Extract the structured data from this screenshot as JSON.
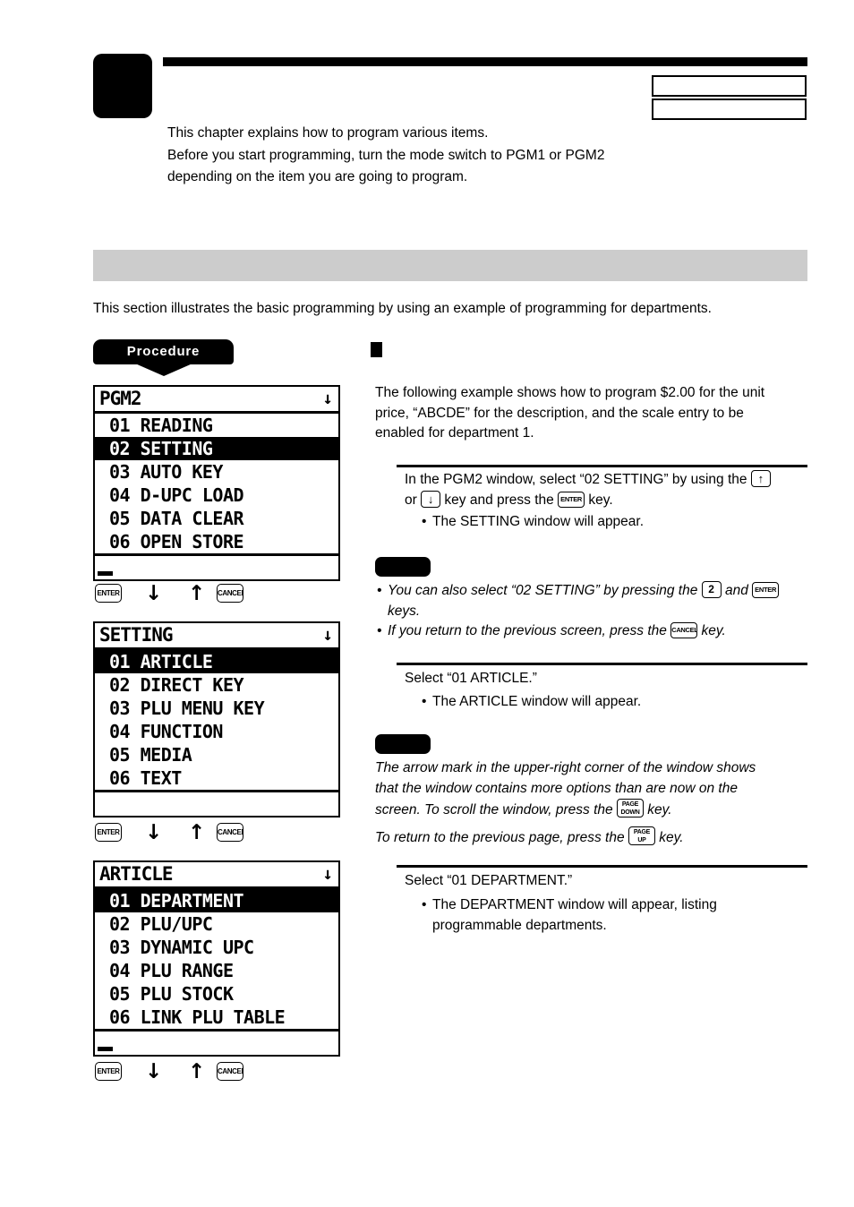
{
  "header": {
    "chapter_tab_label": "",
    "chapter_title": "",
    "box_1": "",
    "box_2": "",
    "intro_line_1": "This chapter explains how to program various items.",
    "intro_line_2": "Before you start programming, turn the mode switch to PGM1 or PGM2",
    "intro_line_3": "depending on the item you are going to program."
  },
  "section": {
    "band_title": "",
    "intro": "This section illustrates the basic programming by using an example of programming for departments.",
    "procedure_badge_label": "Procedure",
    "sub_heading": "",
    "example_line_1": "The following example shows how to program $2.00 for the unit",
    "example_line_2": "price, “ABCDE” for the description, and the scale entry to be",
    "example_line_3": "enabled for department 1."
  },
  "steps": [
    {
      "id": "step-1",
      "line_1_a": "In the PGM2 window, select “02 SETTING” by using the",
      "line_2_a": "or",
      "line_2_b": "key and press the",
      "line_2_c": "key.",
      "bullet_1": "The SETTING window will appear.",
      "key_up": "↑",
      "key_down": "↓",
      "key_enter": "ENTER"
    },
    {
      "id": "step-2",
      "line_1": "Select “01 ARTICLE.”",
      "bullet_1": "The ARTICLE window will appear."
    },
    {
      "id": "step-3",
      "line_1": "Select “01 DEPARTMENT.”",
      "bullet_1": "The DEPARTMENT window will appear, listing",
      "bullet_1_cont": "programmable departments."
    }
  ],
  "notes": [
    {
      "id": "note-1",
      "badge_label": "",
      "bullet_1_a": "You can also select “02 SETTING” by pressing the",
      "bullet_1_b": "and",
      "bullet_1_c": "keys.",
      "bullet_2_a": "If you return to the previous screen, press the",
      "bullet_2_b": "key.",
      "key_num": "2",
      "key_enter": "ENTER",
      "key_cancel": "CANCEL"
    },
    {
      "id": "note-2",
      "badge_label": "",
      "line_1": "The arrow mark in the upper-right corner of the window shows",
      "line_2": "that the window contains more options than are now on the",
      "line_3_a": "screen. To scroll the window, press the",
      "line_3_b": "key.",
      "line_4_a": "To return to the previous page, press the",
      "line_4_b": "key.",
      "key_page_down_top": "PAGE",
      "key_page_down_bottom": "DOWN",
      "key_page_up_top": "PAGE",
      "key_page_up_bottom": "UP"
    }
  ],
  "lcd_screens": [
    {
      "id": "lcd-pgm2",
      "title": "PGM2",
      "scroll_arrow": "↓",
      "rows": [
        {
          "num": "01",
          "label": "READING",
          "selected": false
        },
        {
          "num": "02",
          "label": "SETTING",
          "selected": true
        },
        {
          "num": "03",
          "label": "AUTO KEY",
          "selected": false
        },
        {
          "num": "04",
          "label": "D-UPC LOAD",
          "selected": false
        },
        {
          "num": "05",
          "label": "DATA CLEAR",
          "selected": false
        },
        {
          "num": "06",
          "label": "OPEN STORE",
          "selected": false
        }
      ],
      "has_cursor": true,
      "input_value": ""
    },
    {
      "id": "lcd-setting",
      "title": "SETTING",
      "scroll_arrow": "↓",
      "rows": [
        {
          "num": "01",
          "label": "ARTICLE",
          "selected": true
        },
        {
          "num": "02",
          "label": "DIRECT KEY",
          "selected": false
        },
        {
          "num": "03",
          "label": "PLU MENU KEY",
          "selected": false
        },
        {
          "num": "04",
          "label": "FUNCTION",
          "selected": false
        },
        {
          "num": "05",
          "label": "MEDIA",
          "selected": false
        },
        {
          "num": "06",
          "label": "TEXT",
          "selected": false
        }
      ],
      "has_cursor": false,
      "input_value": ""
    },
    {
      "id": "lcd-article",
      "title": "ARTICLE",
      "scroll_arrow": "↓",
      "rows": [
        {
          "num": "01",
          "label": "DEPARTMENT",
          "selected": true
        },
        {
          "num": "02",
          "label": "PLU/UPC",
          "selected": false
        },
        {
          "num": "03",
          "label": "DYNAMIC UPC",
          "selected": false
        },
        {
          "num": "04",
          "label": "PLU RANGE",
          "selected": false
        },
        {
          "num": "05",
          "label": "PLU STOCK",
          "selected": false
        },
        {
          "num": "06",
          "label": "LINK PLU TABLE",
          "selected": false
        }
      ],
      "has_cursor": true,
      "input_value": ""
    }
  ],
  "key_rows": {
    "enter_label": "ENTER",
    "cancel_label": "CANCEL",
    "down_arrow": "↓",
    "up_arrow": "↑"
  }
}
